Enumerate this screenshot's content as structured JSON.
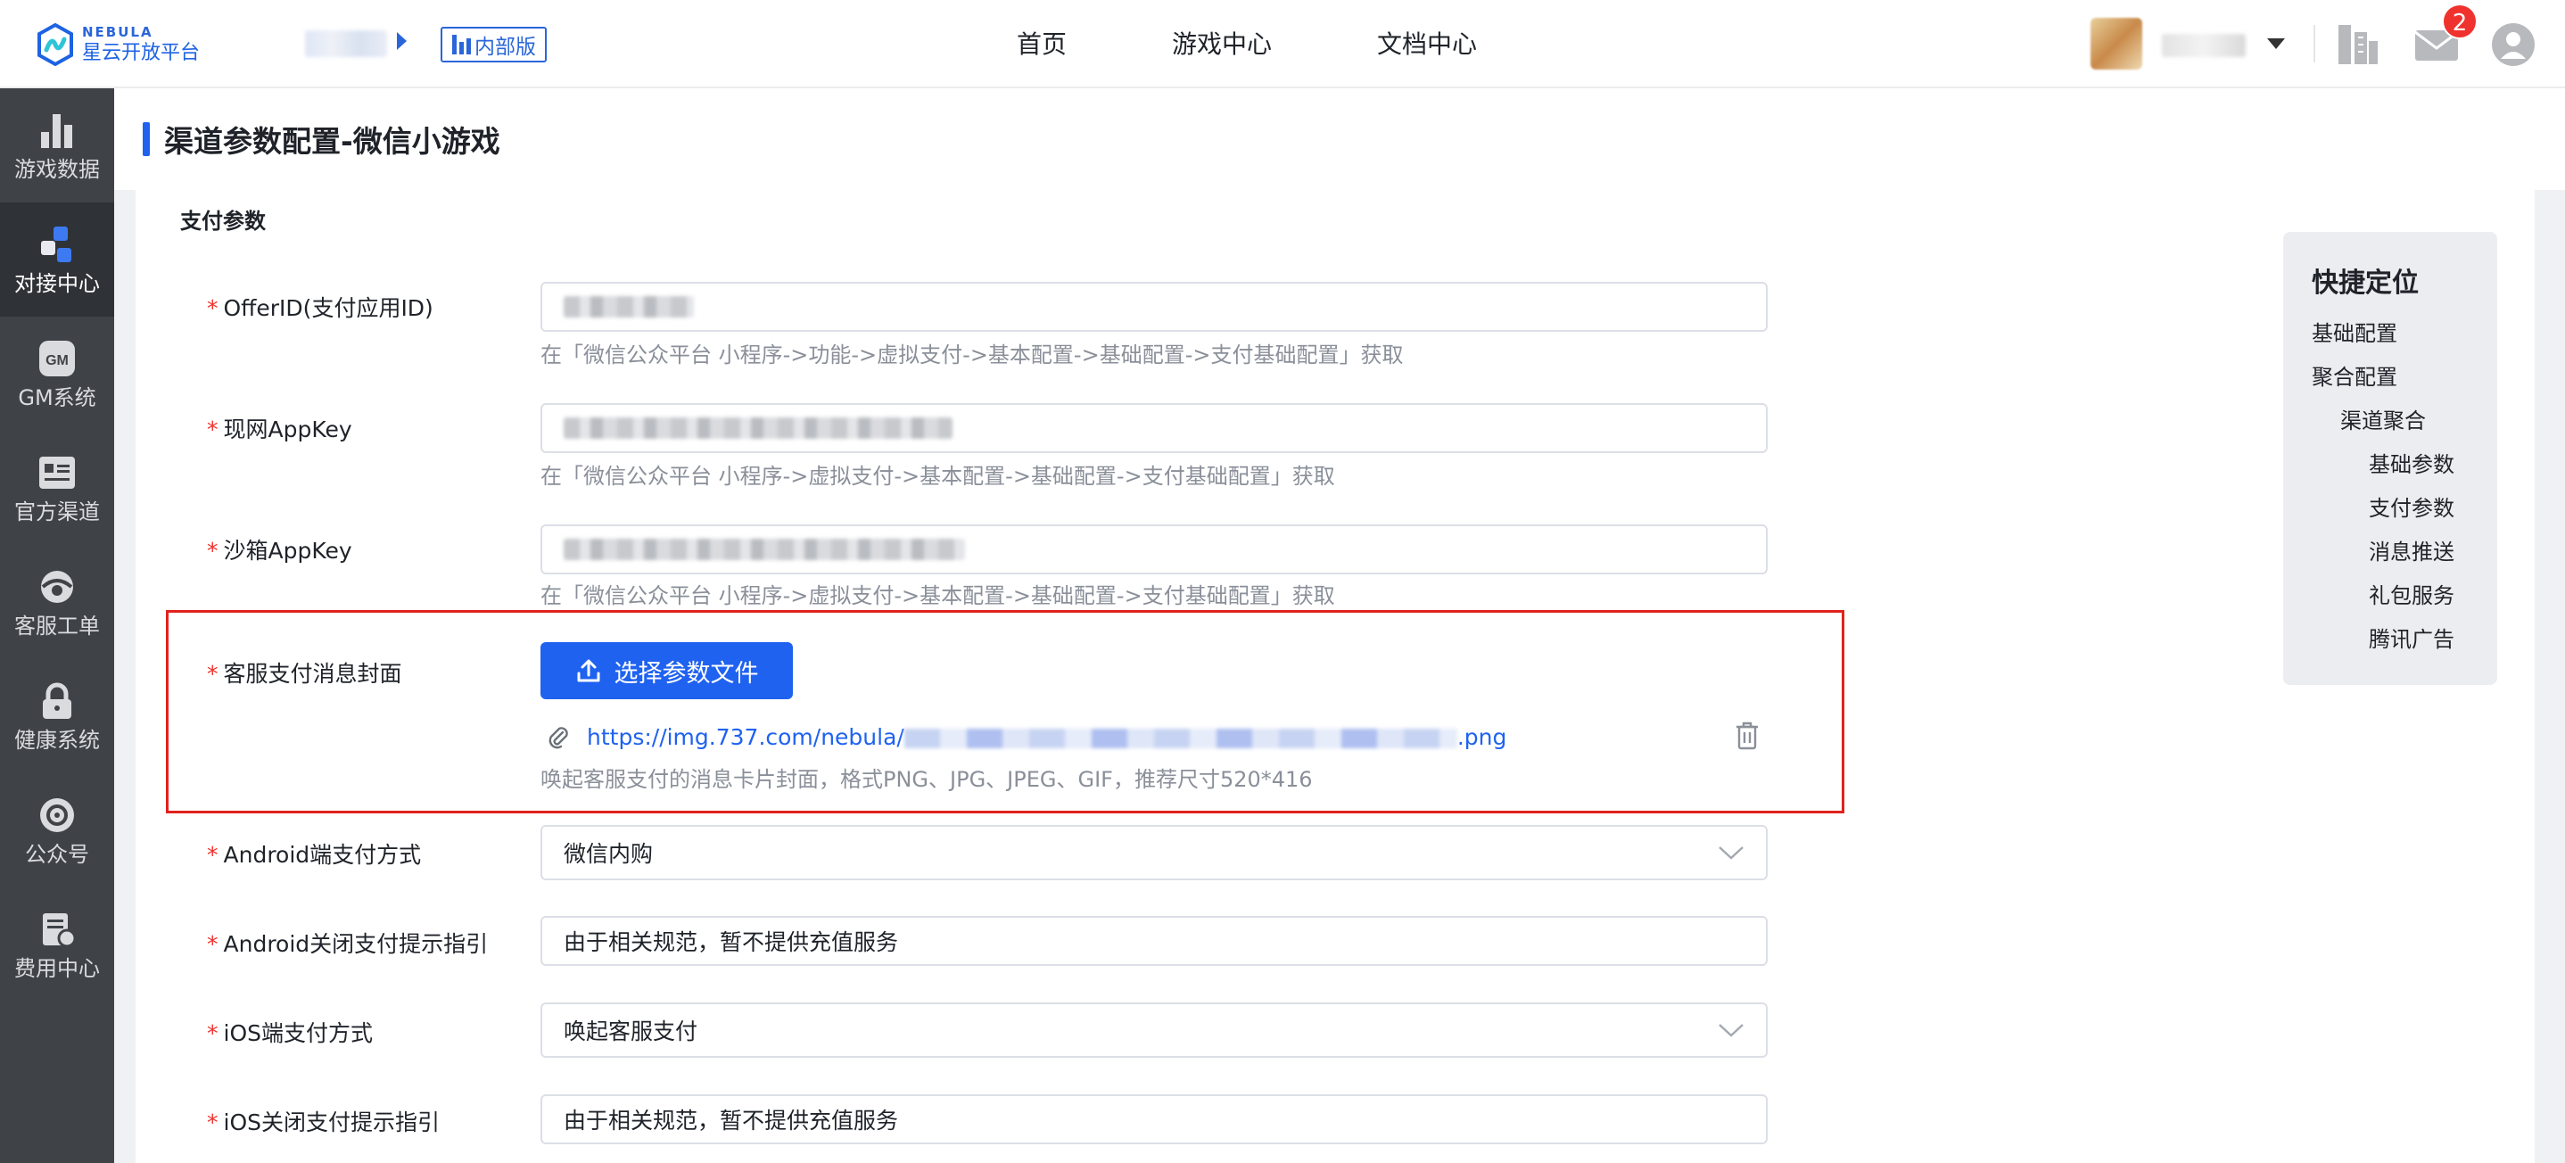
{
  "header": {
    "logo_en": "NEBULA",
    "logo_cn": "星云开放平台",
    "internal_badge": "内部版",
    "nav": [
      "首页",
      "游戏中心",
      "文档中心"
    ],
    "mail_badge_count": "2"
  },
  "sidebar": {
    "items": [
      {
        "label": "游戏数据",
        "icon": "bar-chart-icon"
      },
      {
        "label": "对接中心",
        "icon": "connect-icon",
        "active": true
      },
      {
        "label": "GM系统",
        "icon": "gm-icon"
      },
      {
        "label": "官方渠道",
        "icon": "id-card-icon"
      },
      {
        "label": "客服工单",
        "icon": "customer-service-icon"
      },
      {
        "label": "健康系统",
        "icon": "lock-icon"
      },
      {
        "label": "公众号",
        "icon": "official-account-icon"
      },
      {
        "label": "费用中心",
        "icon": "billing-icon"
      }
    ]
  },
  "page": {
    "title": "渠道参数配置-微信小游戏",
    "section": "支付参数"
  },
  "form": {
    "offer_id": {
      "label": "OfferID(支付应用ID)",
      "hint": "在「微信公众平台 小程序->功能->虚拟支付->基本配置->基础配置->支付基础配置」获取"
    },
    "live_appkey": {
      "label": "现网AppKey",
      "hint": "在「微信公众平台 小程序->虚拟支付->基本配置->基础配置->支付基础配置」获取"
    },
    "sandbox_appkey": {
      "label": "沙箱AppKey",
      "hint": "在「微信公众平台 小程序->虚拟支付->基本配置->基础配置->支付基础配置」获取"
    },
    "cover": {
      "label": "客服支付消息封面",
      "button": "选择参数文件",
      "file_prefix": "https://img.737.com/nebula/",
      "file_suffix": ".png",
      "hint": "唤起客服支付的消息卡片封面，格式PNG、JPG、JPEG、GIF，推荐尺寸520*416"
    },
    "android_pay": {
      "label": "Android端支付方式",
      "value": "微信内购"
    },
    "android_close_tip": {
      "label": "Android关闭支付提示指引",
      "value": "由于相关规范，暂不提供充值服务"
    },
    "ios_pay": {
      "label": "iOS端支付方式",
      "value": "唤起客服支付"
    },
    "ios_close_tip": {
      "label": "iOS关闭支付提示指引",
      "value": "由于相关规范，暂不提供充值服务"
    }
  },
  "quick_locate": {
    "title": "快捷定位",
    "items": [
      "基础配置",
      "聚合配置",
      "渠道聚合",
      "基础参数",
      "支付参数",
      "消息推送",
      "礼包服务",
      "腾讯广告"
    ]
  },
  "colors": {
    "primary": "#1f62f0",
    "required": "#f0322e",
    "highlight": "#e0221d",
    "sidebar_bg": "#3f4348"
  }
}
